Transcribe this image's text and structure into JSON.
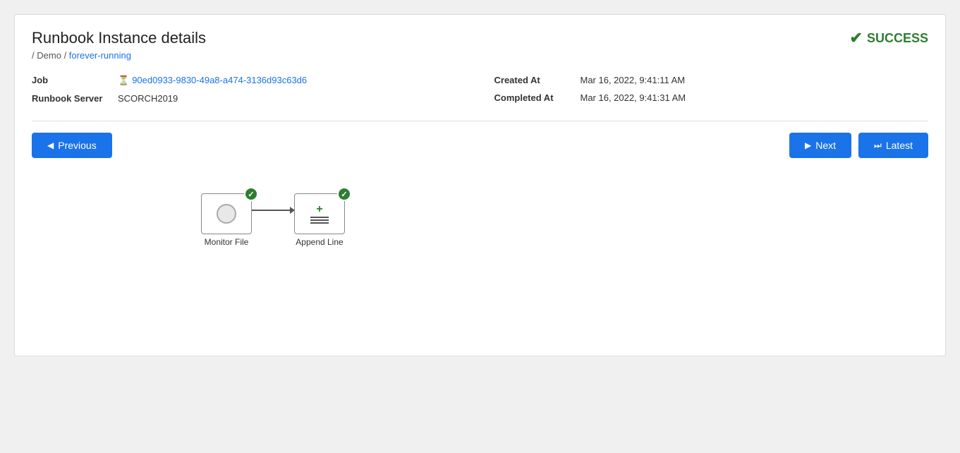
{
  "page": {
    "title_prefix": "Runbook ",
    "title_main": "Instance details",
    "status": "SUCCESS",
    "breadcrumb": {
      "separator": "/",
      "parent": "Demo",
      "current": "forever-running"
    },
    "meta": {
      "job_label": "Job",
      "job_icon": "⏳",
      "job_id": "90ed0933-9830-49a8-a474-3136d93c63d6",
      "runbook_server_label": "Runbook Server",
      "runbook_server_value": "SCORCH2019",
      "created_at_label": "Created At",
      "created_at_value": "Mar 16, 2022, 9:41:11 AM",
      "completed_at_label": "Completed At",
      "completed_at_value": "Mar 16, 2022, 9:41:31 AM"
    },
    "nav": {
      "previous_label": "Previous",
      "next_label": "Next",
      "latest_label": "Latest"
    },
    "workflow": {
      "nodes": [
        {
          "id": "monitor-file",
          "label": "Monitor File",
          "success": true
        },
        {
          "id": "append-line",
          "label": "Append Line",
          "success": true
        }
      ]
    }
  }
}
